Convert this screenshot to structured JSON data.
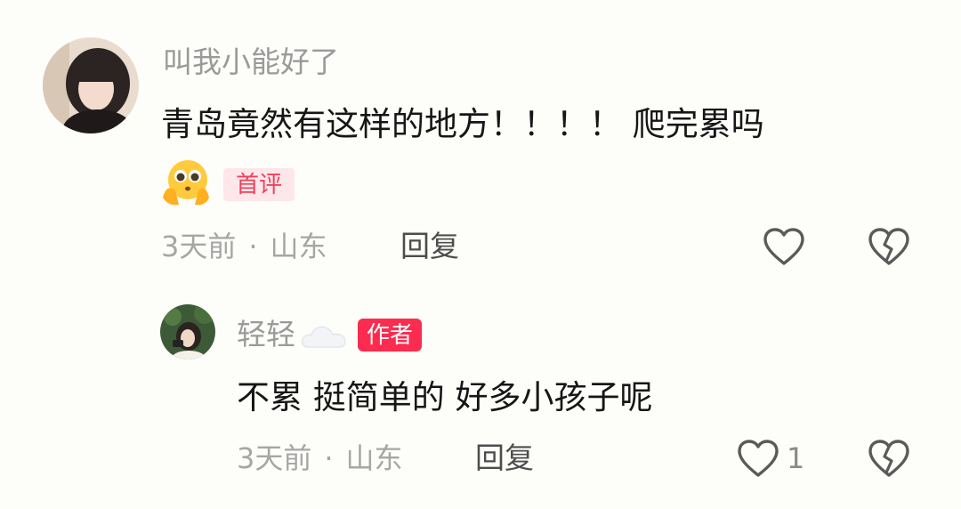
{
  "comments": [
    {
      "username": "叫我小能好了",
      "text": "青岛竟然有这样的地方！！！！ 爬完累吗",
      "emoji": "pleading-face-emoji",
      "badge": "首评",
      "time": "3天前",
      "location": "山东",
      "reply_label": "回复",
      "like_count": ""
    },
    {
      "username": "轻轻",
      "badge": "作者",
      "text": "不累 挺简单的 好多小孩子呢",
      "time": "3天前",
      "location": "山东",
      "reply_label": "回复",
      "like_count": "1"
    }
  ],
  "separator": "·",
  "icons": {
    "like": "heart-outline-icon",
    "dislike": "broken-heart-icon",
    "cloud": "cloud-icon"
  },
  "colors": {
    "username": "#9a9a9a",
    "text": "#161616",
    "meta": "#a6a6a6",
    "first_badge_bg": "#fde7ea",
    "first_badge_fg": "#f0405c",
    "author_badge_bg": "#fb2c4f",
    "icon": "#5a5a5a"
  }
}
